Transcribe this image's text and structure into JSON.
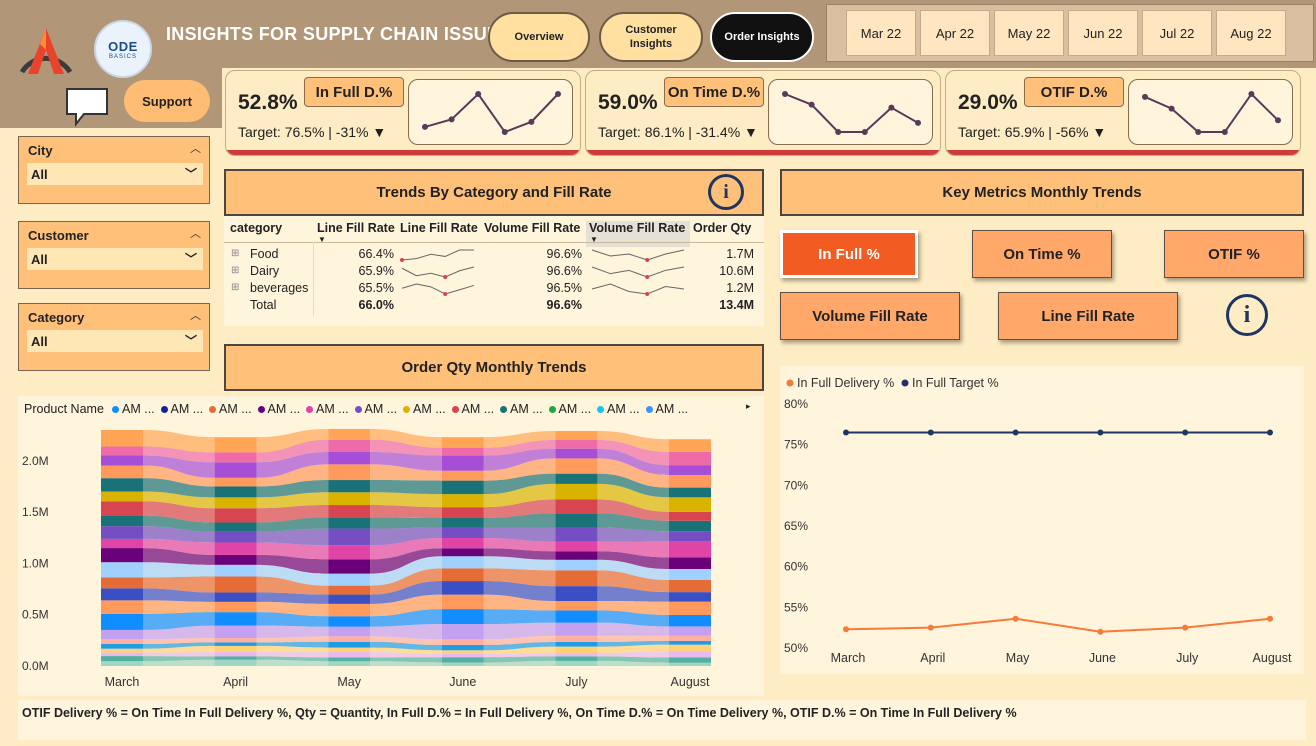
{
  "header": {
    "title": "INSIGHTS FOR SUPPLY CHAIN ISSUE",
    "logo_text": "ODE",
    "logo_sub": "BASICS",
    "nav": [
      {
        "label": "Overview",
        "active": false
      },
      {
        "label": "Customer\nInsights",
        "active": false
      },
      {
        "label": "Order Insights",
        "active": true
      }
    ],
    "months": [
      "Mar 22",
      "Apr 22",
      "May 22",
      "Jun 22",
      "Jul 22",
      "Aug 22"
    ]
  },
  "sidebar": {
    "support_label": "Support",
    "filters": [
      {
        "label": "City",
        "value": "All"
      },
      {
        "label": "Customer",
        "value": "All"
      },
      {
        "label": "Category",
        "value": "All"
      }
    ]
  },
  "kpis": [
    {
      "value": "52.8%",
      "label": "In Full D.%",
      "target": "Target: 76.5% | -31% ▼",
      "spark": [
        52.3,
        52.6,
        53.6,
        52.1,
        52.5,
        53.6
      ]
    },
    {
      "value": "59.0%",
      "label": "On Time D.%",
      "target": "Target: 86.1% | -31.4% ▼",
      "spark": [
        60.5,
        59.8,
        58.0,
        58.0,
        59.6,
        58.6
      ]
    },
    {
      "value": "29.0%",
      "label": "OTIF D.%",
      "target": "Target: 65.9% | -56% ▼",
      "spark": [
        29.6,
        29.2,
        28.4,
        28.4,
        29.7,
        28.8
      ]
    }
  ],
  "trends_category": {
    "title": "Trends By Category and Fill Rate",
    "columns": [
      "category",
      "Line Fill Rate",
      "Line Fill Rate",
      "Volume Fill Rate",
      "Volume Fill Rate",
      "Order Qty"
    ],
    "rows": [
      {
        "name": "Food",
        "lfr": "66.4%",
        "vfr": "96.6%",
        "qty": "1.7M",
        "lfr_spark": [
          66.0,
          66.2,
          66.8,
          66.5,
          67.4,
          67.4
        ],
        "vfr_spark": [
          96.8,
          96.5,
          96.6,
          96.3,
          96.6,
          96.8
        ]
      },
      {
        "name": "Dairy",
        "lfr": "65.9%",
        "vfr": "96.6%",
        "qty": "10.6M",
        "lfr_spark": [
          66.2,
          65.6,
          65.8,
          65.5,
          66.0,
          66.3
        ],
        "vfr_spark": [
          96.7,
          96.5,
          96.6,
          96.4,
          96.6,
          96.7
        ]
      },
      {
        "name": "beverages",
        "lfr": "65.5%",
        "vfr": "96.5%",
        "qty": "1.2M",
        "lfr_spark": [
          65.6,
          65.9,
          65.7,
          65.2,
          65.5,
          65.8
        ],
        "vfr_spark": [
          96.5,
          96.7,
          96.4,
          96.3,
          96.6,
          96.5
        ]
      }
    ],
    "total": {
      "name": "Total",
      "lfr": "66.0%",
      "vfr": "96.6%",
      "qty": "13.4M"
    }
  },
  "key_metrics": {
    "title": "Key Metrics Monthly Trends",
    "buttons": [
      "In Full %",
      "On Time %",
      "OTIF %",
      "Volume Fill Rate",
      "Line Fill Rate"
    ],
    "active": "In Full %"
  },
  "order_qty": {
    "title": "Order Qty Monthly Trends",
    "legend_title": "Product Name",
    "legend_items": [
      "AM ...",
      "AM ...",
      "AM ...",
      "AM ...",
      "AM ...",
      "AM ...",
      "AM ...",
      "AM ...",
      "AM ...",
      "AM ...",
      "AM ...",
      "AM ..."
    ],
    "legend_colors": [
      "#118dff",
      "#12239e",
      "#e66c37",
      "#6b007b",
      "#e044a7",
      "#744ec2",
      "#d9b300",
      "#d64550",
      "#197278",
      "#1aab40",
      "#15c6f4",
      "#4092ff"
    ]
  },
  "chart_data": [
    {
      "type": "area",
      "title": "Order Qty Monthly Trends",
      "x": [
        "March",
        "April",
        "May",
        "June",
        "July",
        "August"
      ],
      "y_ticks": [
        "0.0M",
        "0.5M",
        "1.0M",
        "1.5M",
        "2.0M"
      ],
      "ylim": [
        0,
        2300000
      ],
      "totals": [
        2300000,
        2230000,
        2310000,
        2230000,
        2290000,
        2210000
      ],
      "series_colors": [
        "#9fd6c4",
        "#51b0a0",
        "#e8b9f0",
        "#ffd27a",
        "#1f9ce6",
        "#ffb0a0",
        "#c4a0f0",
        "#118dff",
        "#ff9a5c",
        "#3a4fc4",
        "#e66c37",
        "#a0d0ff",
        "#6b007b",
        "#e044a7",
        "#744ec2",
        "#197278",
        "#d64550",
        "#d9b300",
        "#197278",
        "#ff9a5c",
        "#a64fd6",
        "#ee6aa8",
        "#ffa555"
      ]
    },
    {
      "type": "line",
      "legend": [
        "In Full Delivery %",
        "In Full Target %"
      ],
      "x": [
        "March",
        "April",
        "May",
        "June",
        "July",
        "August"
      ],
      "series": [
        {
          "name": "In Full Delivery %",
          "color": "#f47b3a",
          "values": [
            52.3,
            52.5,
            53.6,
            52.0,
            52.5,
            53.6
          ]
        },
        {
          "name": "In Full Target %",
          "color": "#1f3562",
          "values": [
            76.5,
            76.5,
            76.5,
            76.5,
            76.5,
            76.5
          ]
        }
      ],
      "y_ticks": [
        "50%",
        "55%",
        "60%",
        "65%",
        "70%",
        "75%",
        "80%"
      ],
      "ylim": [
        50,
        80
      ]
    }
  ],
  "footer": {
    "text": "OTIF Delivery % = On Time In Full Delivery %, Qty = Quantity, In Full D.% = In Full Delivery %, On Time D.% = On Time Delivery %, OTIF D.% = On Time In Full Delivery %"
  }
}
